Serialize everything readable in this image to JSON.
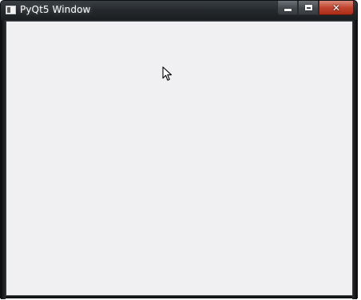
{
  "window": {
    "title": "PyQt5 Window"
  },
  "caption_buttons": {
    "minimize": "minimize-icon",
    "maximize": "maximize-icon",
    "close": "close-icon",
    "close_glyph": "✕"
  },
  "colors": {
    "client_background": "#f0f0f2",
    "titlebar": "#25292d",
    "close_button": "#c1452f"
  }
}
